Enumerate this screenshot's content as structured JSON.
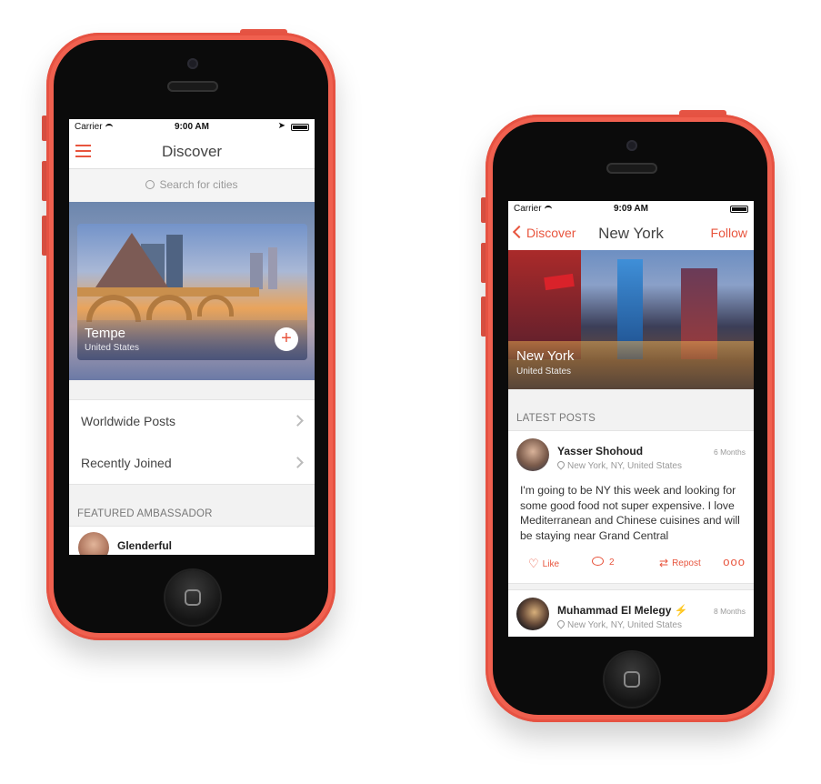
{
  "left_phone": {
    "status": {
      "carrier": "Carrier",
      "time": "9:00 AM"
    },
    "nav": {
      "title": "Discover"
    },
    "search": {
      "placeholder": "Search for cities"
    },
    "hero": {
      "city": "Tempe",
      "country": "United States"
    },
    "list": [
      {
        "label": "Worldwide Posts"
      },
      {
        "label": "Recently Joined"
      }
    ],
    "featured_header": "FEATURED AMBASSADOR",
    "ambassador": {
      "name": "Glenderful"
    }
  },
  "right_phone": {
    "status": {
      "carrier": "Carrier",
      "time": "9:09 AM"
    },
    "nav": {
      "back_label": "Discover",
      "title": "New York",
      "follow_label": "Follow"
    },
    "hero": {
      "city": "New York",
      "country": "United States"
    },
    "latest_header": "LATEST POSTS",
    "posts": [
      {
        "author": "Yasser Shohoud",
        "time": "6 Months",
        "location": "New York, NY, United States",
        "body": "I'm going to be NY this week and looking for some good food not super expensive. I love Mediterranean and Chinese cuisines and will be staying near Grand Central",
        "like_label": "Like",
        "comment_count": "2",
        "repost_label": "Repost",
        "more": "ooo"
      },
      {
        "author": "Muhammad El Melegy",
        "badge": "⚡",
        "time": "8 Months",
        "location": "New York, NY, United States"
      }
    ]
  },
  "colors": {
    "accent": "#e8553e",
    "phone_shell": "#f0604f",
    "bezel": "#0b0b0b"
  }
}
